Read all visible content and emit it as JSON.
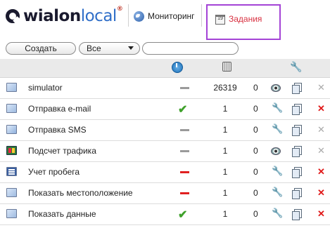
{
  "header": {
    "logo_main": "wialon",
    "logo_accent": "local",
    "logo_sup": "®",
    "tabs": [
      {
        "label": "Мониторинг"
      },
      {
        "label": "Задания",
        "active": true
      }
    ],
    "active_tab_border_color": "#a443d6",
    "calendar_icon_text": "19"
  },
  "toolbar": {
    "create_label": "Создать",
    "filter_value": "Все",
    "search_value": ""
  },
  "table": {
    "columns": [
      "",
      "",
      "state",
      "counter",
      "",
      "edit",
      "copy",
      "delete"
    ],
    "rows": [
      {
        "type_icon": "task-icon",
        "name": "simulator",
        "state": "disabled",
        "count": "26319",
        "extra": "0",
        "action": "view",
        "deletable": false
      },
      {
        "type_icon": "email-icon",
        "name": "Отправка e-mail",
        "state": "ok",
        "count": "1",
        "extra": "0",
        "action": "edit",
        "deletable": true
      },
      {
        "type_icon": "sms-icon",
        "name": "Отправка SMS",
        "state": "disabled",
        "count": "1",
        "extra": "0",
        "action": "edit",
        "deletable": false
      },
      {
        "type_icon": "traffic-icon",
        "name": "Подсчет трафика",
        "state": "disabled",
        "count": "1",
        "extra": "0",
        "action": "view",
        "deletable": false
      },
      {
        "type_icon": "mileage-icon",
        "name": "Учет пробега",
        "state": "error",
        "count": "1",
        "extra": "0",
        "action": "edit",
        "deletable": true
      },
      {
        "type_icon": "location-icon",
        "name": "Показать местоположение",
        "state": "error",
        "count": "1",
        "extra": "0",
        "action": "edit",
        "deletable": true
      },
      {
        "type_icon": "data-icon",
        "name": "Показать данные",
        "state": "ok",
        "count": "1",
        "extra": "0",
        "action": "edit",
        "deletable": true
      }
    ]
  },
  "colors": {
    "ok": "#3fa12b",
    "error": "#e02020",
    "tab_active_text": "#d83040"
  }
}
